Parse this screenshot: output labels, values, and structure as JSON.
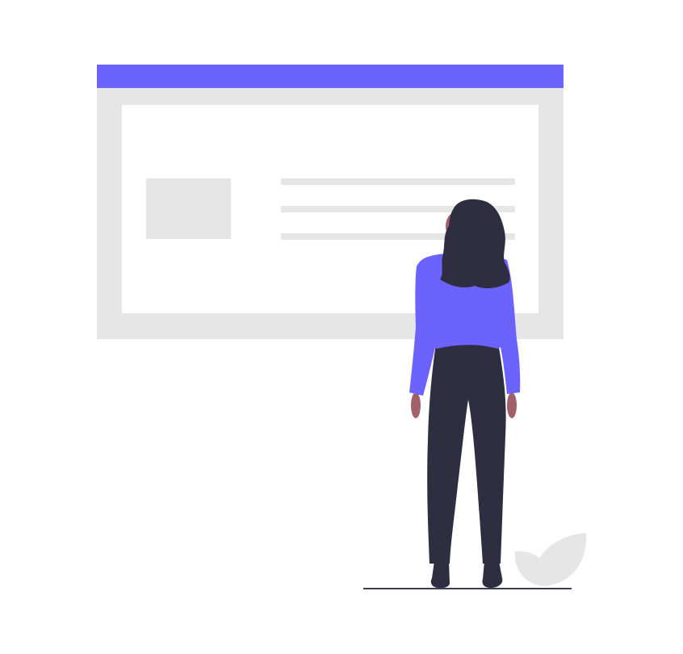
{
  "illustration": {
    "subject": "woman-looking-at-webpage",
    "colors": {
      "accent": "#6c63ff",
      "panel": "#e6e6e6",
      "content": "#ffffff",
      "dark": "#2f2e41",
      "skin": "#a0616a",
      "ground": "#3f3d56"
    },
    "icons": [
      "browser-window",
      "image-placeholder",
      "text-lines",
      "person",
      "leaf-plant"
    ]
  }
}
